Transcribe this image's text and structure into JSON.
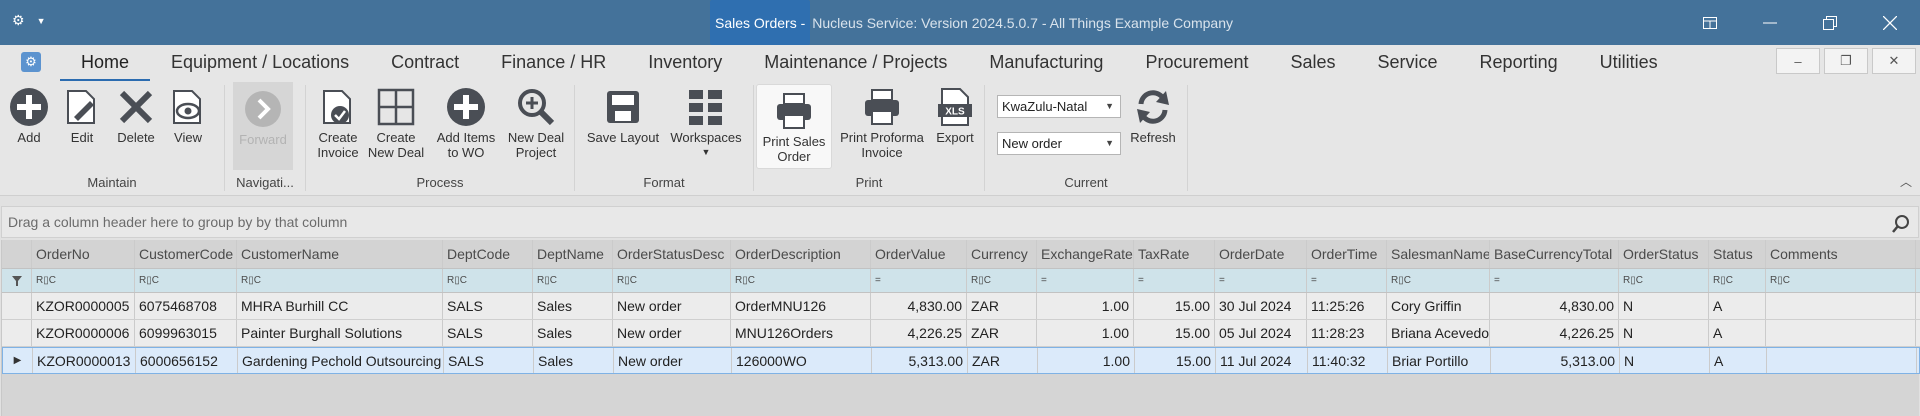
{
  "titlebar": {
    "active_title": "Sales Orders -",
    "title_rest": " Nucleus Service: Version 2024.5.0.7 - All Things Example Company"
  },
  "menu": {
    "tabs": [
      "Home",
      "Equipment / Locations",
      "Contract",
      "Finance / HR",
      "Inventory",
      "Maintenance / Projects",
      "Manufacturing",
      "Procurement",
      "Sales",
      "Service",
      "Reporting",
      "Utilities"
    ],
    "active_tab": "Home"
  },
  "ribbon": {
    "maintain": {
      "label": "Maintain",
      "add": "Add",
      "edit": "Edit",
      "delete": "Delete",
      "view": "View"
    },
    "navigation": {
      "label": "Navigati...",
      "forward": "Forward"
    },
    "process": {
      "label": "Process",
      "create_invoice_1": "Create",
      "create_invoice_2": "Invoice",
      "create_deal_1": "Create",
      "create_deal_2": "New Deal",
      "add_items_1": "Add Items",
      "add_items_2": "to WO",
      "new_deal_project_1": "New Deal",
      "new_deal_project_2": "Project"
    },
    "format": {
      "label": "Format",
      "save_layout": "Save Layout",
      "workspaces": "Workspaces"
    },
    "print": {
      "label": "Print",
      "print_sales_1": "Print Sales",
      "print_sales_2": "Order",
      "print_proforma_1": "Print Proforma",
      "print_proforma_2": "Invoice",
      "export": "Export",
      "xls": "XLS"
    },
    "current": {
      "label": "Current",
      "region": "KwaZulu-Natal",
      "status": "New order",
      "refresh": "Refresh"
    }
  },
  "groupby_hint": "Drag a column header here to group by by that column",
  "grid": {
    "columns": [
      "OrderNo",
      "CustomerCode",
      "CustomerName",
      "DeptCode",
      "DeptName",
      "OrderStatusDesc",
      "OrderDescription",
      "OrderValue",
      "Currency",
      "ExchangeRate",
      "TaxRate",
      "OrderDate",
      "OrderTime",
      "SalesmanName",
      "BaseCurrencyTotal",
      "OrderStatus",
      "Status",
      "Comments"
    ],
    "filter_glyphs": [
      "R▯C",
      "R▯C",
      "R▯C",
      "R▯C",
      "R▯C",
      "R▯C",
      "R▯C",
      "=",
      "R▯C",
      "=",
      "=",
      "=",
      "=",
      "R▯C",
      "=",
      "R▯C",
      "R▯C",
      "R▯C"
    ],
    "rows": [
      [
        "KZOR0000005",
        "6075468708",
        "MHRA Burhill CC",
        "SALS",
        "Sales",
        "New order",
        "OrderMNU126",
        "4,830.00",
        "ZAR",
        "1.00",
        "15.00",
        "30 Jul 2024",
        "11:25:26",
        "Cory Griffin",
        "4,830.00",
        "N",
        "A",
        ""
      ],
      [
        "KZOR0000006",
        "6099963015",
        "Painter Burghall Solutions",
        "SALS",
        "Sales",
        "New order",
        "MNU126Orders",
        "4,226.25",
        "ZAR",
        "1.00",
        "15.00",
        "05 Jul 2024",
        "11:28:23",
        "Briana Acevedo",
        "4,226.25",
        "N",
        "A",
        ""
      ],
      [
        "KZOR0000013",
        "6000656152",
        "Gardening Pechold Outsourcing",
        "SALS",
        "Sales",
        "New order",
        "126000WO",
        "5,313.00",
        "ZAR",
        "1.00",
        "15.00",
        "11 Jul 2024",
        "11:40:32",
        "Briar Portillo",
        "5,313.00",
        "N",
        "A",
        ""
      ]
    ],
    "selected_row": 2
  }
}
